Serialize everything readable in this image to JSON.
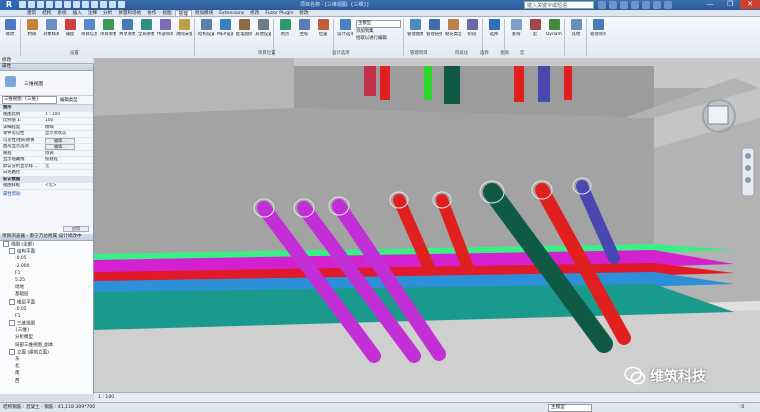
{
  "titlebar": {
    "app_letter": "R",
    "title": "项目名称 - [三维视图: {三维}]",
    "search_placeholder": "键入关键字或短语",
    "window_buttons": [
      "—",
      "❐",
      "✕"
    ]
  },
  "tabs": [
    "建筑",
    "结构",
    "系统",
    "插入",
    "注释",
    "分析",
    "体量和场地",
    "协作",
    "视图",
    "管理",
    "附加模块",
    "Extensions",
    "修改",
    "Fuzor Plugin",
    "修改"
  ],
  "active_tab": 9,
  "ribbon": {
    "buttons": [
      {
        "label": "修改",
        "color": "#4a7cc4"
      },
      {
        "label": "材质",
        "color": "#c2843a"
      },
      {
        "label": "对象样式",
        "color": "#6a8fc2"
      },
      {
        "label": "捕捉",
        "color": "#d04040"
      },
      {
        "label": "项目信息",
        "color": "#5b86c9"
      },
      {
        "label": "项目参数",
        "color": "#3d9a54"
      },
      {
        "label": "共享参数",
        "color": "#4b7ab8"
      },
      {
        "label": "全局参数",
        "color": "#2d8f86"
      },
      {
        "label": "传递项目标准",
        "color": "#7c6bb5"
      },
      {
        "label": "清除未使用项",
        "color": "#b8a145"
      },
      {
        "label": "结构设置",
        "color": "#5d7fa8"
      },
      {
        "label": "MEP设置",
        "color": "#3a7fc0"
      },
      {
        "label": "配电盘明细表样板",
        "color": "#8b6a44"
      },
      {
        "label": "其他设置",
        "color": "#6c7c8c"
      },
      {
        "label": "地点",
        "color": "#2f9b6c"
      },
      {
        "label": "坐标",
        "color": "#5e7bb6"
      },
      {
        "label": "位置",
        "color": "#c05d3a"
      },
      {
        "label": "设计选项",
        "color": "#4c80c2"
      },
      {
        "label": "管理图像",
        "color": "#4d8abf"
      },
      {
        "label": "管理链接",
        "color": "#3d6ea8"
      },
      {
        "label": "贴花类型",
        "color": "#b9804a"
      },
      {
        "label": "阶段",
        "color": "#6a6aa8"
      },
      {
        "label": "选择",
        "color": "#2d70b8"
      },
      {
        "label": "查询",
        "color": "#7e9fca"
      },
      {
        "label": "宏",
        "color": "#a04848"
      },
      {
        "label": "Dynamo",
        "color": "#3f8a3f"
      },
      {
        "label": "其他",
        "color": "#6b8fb8"
      },
      {
        "label": "管理项目",
        "color": "#4a7db8"
      }
    ],
    "panels": [
      "设置",
      "项目位置",
      "设计选项",
      "管理项目",
      "阶段化",
      "选择",
      "查询",
      "宏"
    ],
    "design_option_main": "主模型",
    "design_option_items": [
      "添加到集",
      "拾取以进行编辑"
    ]
  },
  "left": {
    "modify_label": "修改",
    "properties": {
      "header": "属性",
      "type_name": "三维视图",
      "selector_value": "三维视图: {三维}",
      "edit_type": "编辑类型",
      "groups": [
        {
          "name": "图形",
          "rows": [
            [
              "视图比例",
              "1 : 100"
            ],
            [
              "比例值 1:",
              "100"
            ],
            [
              "详细程度",
              "精细"
            ],
            [
              "零件可见性",
              "显示原状态"
            ],
            [
              "可见性/图形替换",
              "编辑..."
            ],
            [
              "图形显示选项",
              "编辑..."
            ],
            [
              "规程",
              "协调"
            ],
            [
              "显示隐藏线",
              "按规程"
            ],
            [
              "默认分析显示样...",
              "无"
            ],
            [
              "日光路径",
              ""
            ]
          ]
        },
        {
          "name": "标识数据",
          "rows": [
            [
              "视图样板",
              "<无>"
            ]
          ]
        }
      ],
      "help_link": "属性帮助",
      "apply_label": "应用"
    },
    "project_browser": {
      "header": "项目浏览器 - 南宁万达附属 设计修改中",
      "nodes": [
        {
          "label": "视图 (全部)",
          "indent": 0
        },
        {
          "label": "结构平面",
          "indent": 1
        },
        {
          "label": "-0.05",
          "indent": 2
        },
        {
          "label": "-2.000",
          "indent": 2
        },
        {
          "label": "F1",
          "indent": 2
        },
        {
          "label": "5.25",
          "indent": 2
        },
        {
          "label": "场地",
          "indent": 2
        },
        {
          "label": "基础层",
          "indent": 2
        },
        {
          "label": "楼层平面",
          "indent": 1
        },
        {
          "label": "-0.05",
          "indent": 2
        },
        {
          "label": "F1",
          "indent": 2
        },
        {
          "label": "三维视图",
          "indent": 1
        },
        {
          "label": "{三维}",
          "indent": 2
        },
        {
          "label": "分析模型",
          "indent": 2
        },
        {
          "label": "局部三维视图_副本",
          "indent": 2
        },
        {
          "label": "立面 (建筑立面)",
          "indent": 1
        },
        {
          "label": "东",
          "indent": 2
        },
        {
          "label": "北",
          "indent": 2
        },
        {
          "label": "南",
          "indent": 2
        },
        {
          "label": "西",
          "indent": 2
        }
      ]
    }
  },
  "viewport": {
    "pipe_colors": [
      "#c22fd6",
      "#c22fd6",
      "#c22fd6",
      "#e0201e",
      "#e0201e",
      "#0f5a45",
      "#e0201e",
      "#4848b0"
    ],
    "band_colors": [
      "#3aef86",
      "#d421cf",
      "#e01a2a",
      "#2d8fd8",
      "#1a9a8c"
    ],
    "viewcube_label": "ViewCube"
  },
  "status": {
    "view_scale": "1 : 100",
    "status_text": "结构钢筋 : 混凝土 - 钢筋 : 41,118  309*700",
    "selection_box": "主模型",
    "zero_count": ":0"
  },
  "watermark": {
    "text": "维筑科技"
  }
}
